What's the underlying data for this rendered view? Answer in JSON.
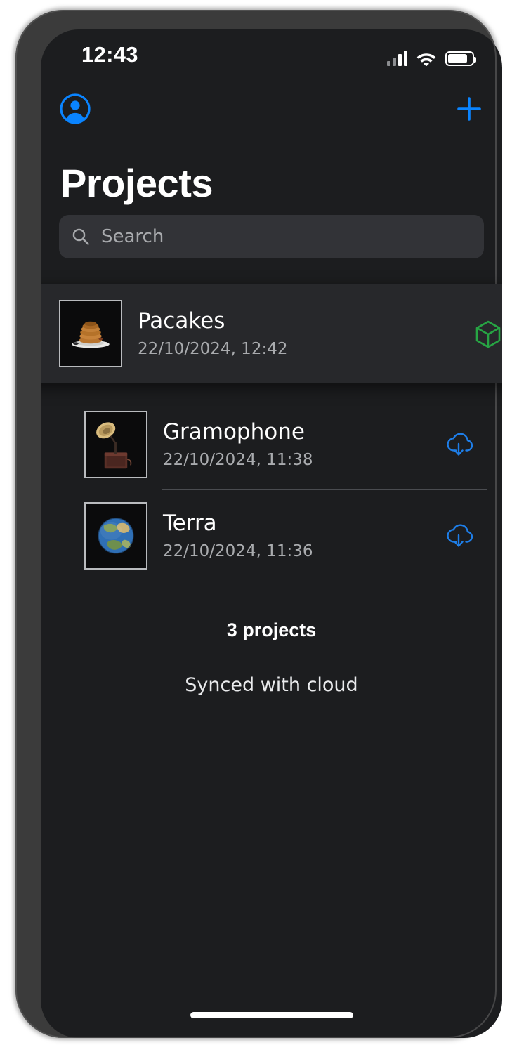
{
  "status_bar": {
    "time": "12:43",
    "signal_icon": "cellular-signal-icon",
    "wifi_icon": "wifi-icon",
    "battery_icon": "battery-icon",
    "battery_level_pct": 73
  },
  "navbar": {
    "account_icon": "account-circle-icon",
    "add_icon": "plus-icon",
    "accent_color": "#0a84ff"
  },
  "header": {
    "title": "Projects"
  },
  "search": {
    "placeholder": "Search",
    "value": "",
    "icon": "search-icon"
  },
  "projects": [
    {
      "name": "Pacakes",
      "date": "22/10/2024, 12:42",
      "thumbnail": "pancakes-on-plate-thumbnail",
      "status_icon": "cube-3d-icon",
      "status_color": "#27a544",
      "selected": true
    },
    {
      "name": "Gramophone",
      "date": "22/10/2024, 11:38",
      "thumbnail": "gramophone-thumbnail",
      "status_icon": "cloud-download-icon",
      "status_color": "#1e7ee8",
      "selected": false
    },
    {
      "name": "Terra",
      "date": "22/10/2024, 11:36",
      "thumbnail": "earth-globe-thumbnail",
      "status_icon": "cloud-download-icon",
      "status_color": "#1e7ee8",
      "selected": false
    }
  ],
  "footer": {
    "count_text": "3 projects",
    "sync_text": "Synced with cloud"
  },
  "home_indicator": "home-indicator"
}
